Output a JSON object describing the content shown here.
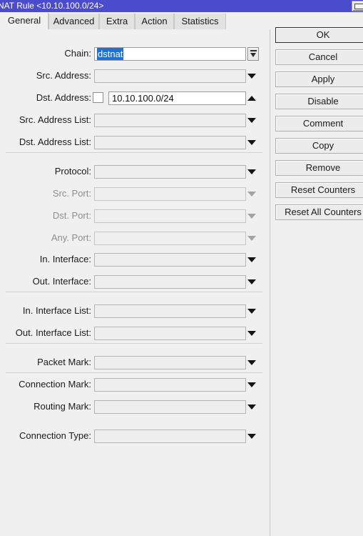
{
  "window": {
    "title": "NAT Rule <10.10.100.0/24>",
    "restore_button": "restore-window-button"
  },
  "tabs": [
    {
      "label": "General",
      "active": true
    },
    {
      "label": "Advanced",
      "active": false
    },
    {
      "label": "Extra",
      "active": false
    },
    {
      "label": "Action",
      "active": false
    },
    {
      "label": "Statistics",
      "active": false
    }
  ],
  "fields": [
    {
      "label": "Chain:",
      "value": "dstnat",
      "state": "editing",
      "control": "combo-button",
      "checkbox": false
    },
    {
      "label": "Src. Address:",
      "value": "",
      "state": "empty",
      "control": "arrow-down",
      "checkbox": false
    },
    {
      "label": "Dst. Address:",
      "value": "10.10.100.0/24",
      "state": "filled",
      "control": "arrow-up",
      "checkbox": true
    },
    {
      "label": "Src. Address List:",
      "value": "",
      "state": "empty",
      "control": "arrow-down",
      "checkbox": false
    },
    {
      "label": "Dst. Address List:",
      "value": "",
      "state": "empty",
      "control": "arrow-down",
      "checkbox": false
    },
    {
      "label": "Protocol:",
      "value": "",
      "state": "empty",
      "control": "arrow-down",
      "checkbox": false
    },
    {
      "label": "Src. Port:",
      "value": "",
      "state": "disabled",
      "control": "arrow-down",
      "checkbox": false
    },
    {
      "label": "Dst. Port:",
      "value": "",
      "state": "disabled",
      "control": "arrow-down",
      "checkbox": false
    },
    {
      "label": "Any. Port:",
      "value": "",
      "state": "disabled",
      "control": "arrow-down",
      "checkbox": false
    },
    {
      "label": "In. Interface:",
      "value": "",
      "state": "empty",
      "control": "arrow-down",
      "checkbox": false
    },
    {
      "label": "Out. Interface:",
      "value": "",
      "state": "empty",
      "control": "arrow-down",
      "checkbox": false
    },
    {
      "label": "In. Interface List:",
      "value": "",
      "state": "empty",
      "control": "arrow-down",
      "checkbox": false
    },
    {
      "label": "Out. Interface List:",
      "value": "",
      "state": "empty",
      "control": "arrow-down",
      "checkbox": false
    },
    {
      "label": "Packet Mark:",
      "value": "",
      "state": "empty",
      "control": "arrow-down",
      "checkbox": false
    },
    {
      "label": "Connection Mark:",
      "value": "",
      "state": "empty",
      "control": "arrow-down",
      "checkbox": false
    },
    {
      "label": "Routing Mark:",
      "value": "",
      "state": "empty",
      "control": "arrow-down",
      "checkbox": false
    },
    {
      "label": "Connection Type:",
      "value": "",
      "state": "empty",
      "control": "arrow-down",
      "checkbox": false
    }
  ],
  "buttons": [
    {
      "label": "OK",
      "default": true
    },
    {
      "label": "Cancel",
      "default": false
    },
    {
      "label": "Apply",
      "default": false
    },
    {
      "label": "Disable",
      "default": false
    },
    {
      "label": "Comment",
      "default": false
    },
    {
      "label": "Copy",
      "default": false
    },
    {
      "label": "Remove",
      "default": false
    },
    {
      "label": "Reset Counters",
      "default": false
    },
    {
      "label": "Reset All Counters",
      "default": false
    }
  ],
  "colors": {
    "titlebar": "#4b4bcd",
    "titlebar_text": "#ffffff",
    "window_bg": "#f0f0f0",
    "selection": "#1f72d4",
    "field_border": "#b4b4b4",
    "disabled_text": "#8d8d8d"
  }
}
